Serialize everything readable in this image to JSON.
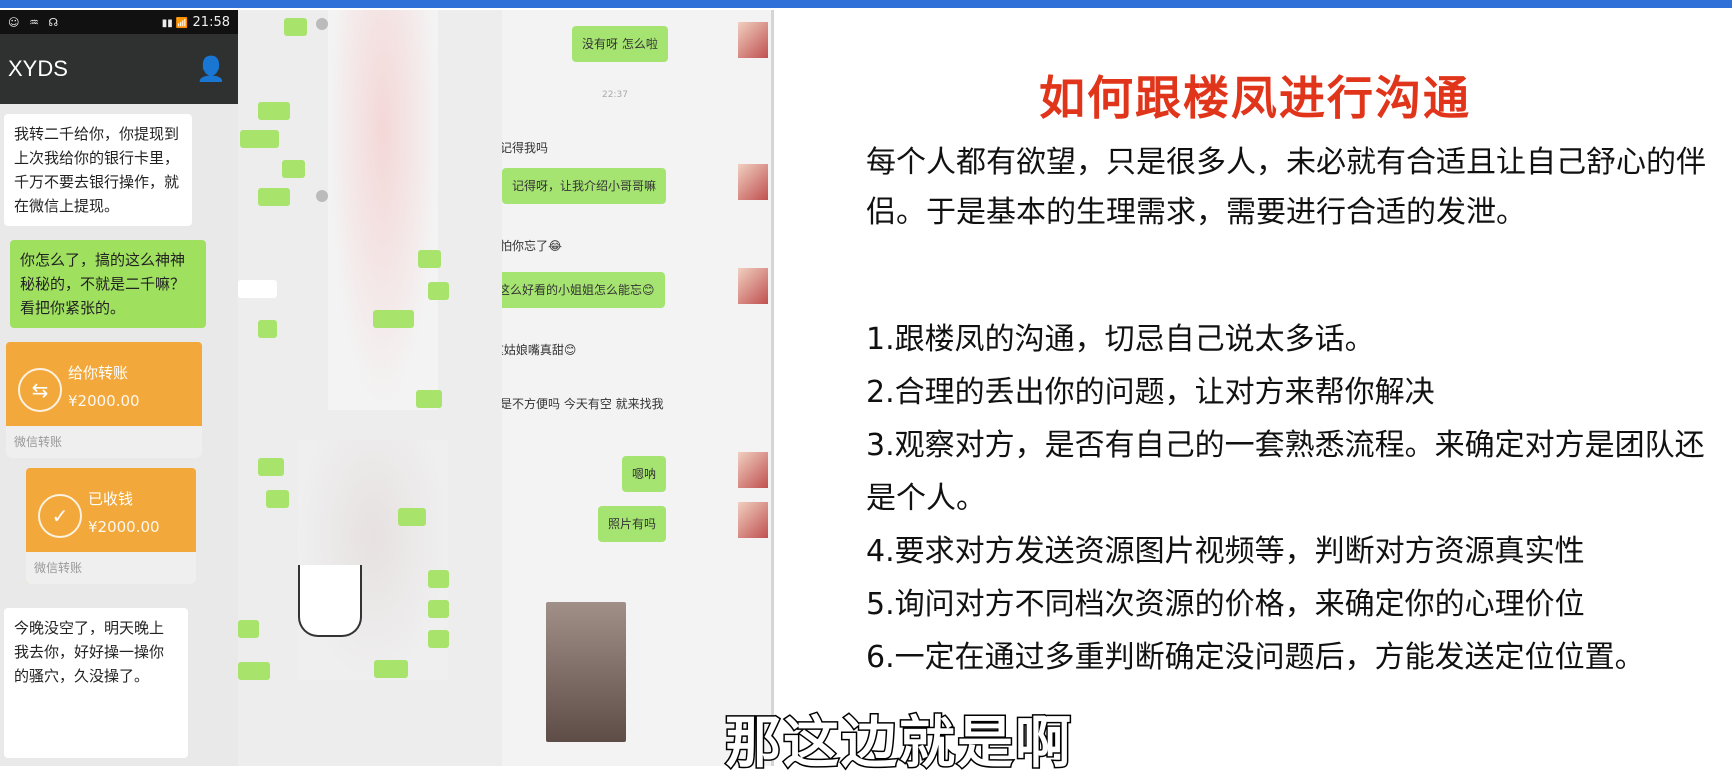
{
  "phone": {
    "status": {
      "icons": "☺ ♒ ☊",
      "signal": "▮▮ 📶",
      "time": "21:58"
    },
    "contact_name": "XYDS",
    "messages": [
      "我转二千给你，你提现到上次我给你的银行卡里，千万不要去银行操作，就在微信上提现。",
      "你怎么了，搞的这么神神秘秘的，不就是二千嘛？看把你紧张的。",
      "今晚没空了，明天晚上我去你，好好操一操你的骚穴，久没操了。"
    ],
    "transfers": [
      {
        "title": "给你转账",
        "amount": "¥2000.00",
        "footer": "微信转账"
      },
      {
        "title": "已收钱",
        "amount": "¥2000.00",
        "footer": "微信转账"
      }
    ]
  },
  "chat_right": {
    "time": "22:37",
    "messages": [
      {
        "text": "没有呀 怎么啦",
        "side": "right"
      },
      {
        "text": "你还记得我吗",
        "side": "left"
      },
      {
        "text": "记得呀，让我介绍小哥哥嘛",
        "side": "right"
      },
      {
        "text": "我还怕你忘了😂",
        "side": "left"
      },
      {
        "text": "这么好看的小姐姐怎么能忘😊",
        "side": "right"
      },
      {
        "text": "哈 这姑娘嘴真甜😊",
        "side": "left"
      },
      {
        "text": "次不是不方便吗 今天有空 就来找我",
        "side": "left"
      },
      {
        "text": "嗯呐",
        "side": "right"
      },
      {
        "text": "照片有吗",
        "side": "right"
      }
    ]
  },
  "slide": {
    "title": "如何跟楼凤进行沟通",
    "intro": "每个人都有欲望，只是很多人，未必就有合适且让自己舒心的伴侣。于是基本的生理需求，需要进行合适的发泄。",
    "points": [
      "1.跟楼凤的沟通，切忌自己说太多话。",
      "2.合理的丢出你的问题，让对方来帮你解决",
      "3.观察对方，是否有自己的一套熟悉流程。来确定对方是团队还是个人。",
      "4.要求对方发送资源图片视频等，判断对方资源真实性",
      "5.询问对方不同档次资源的价格，来确定你的心理价位",
      "6.一定在通过多重判断确定没问题后，方能发送定位位置。"
    ]
  },
  "subtitle": "那这边就是啊",
  "colors": {
    "title": "#e1351b",
    "bubble_green": "#9fe15f",
    "transfer_orange": "#f2a83a",
    "frame": "#2f6fd8"
  }
}
